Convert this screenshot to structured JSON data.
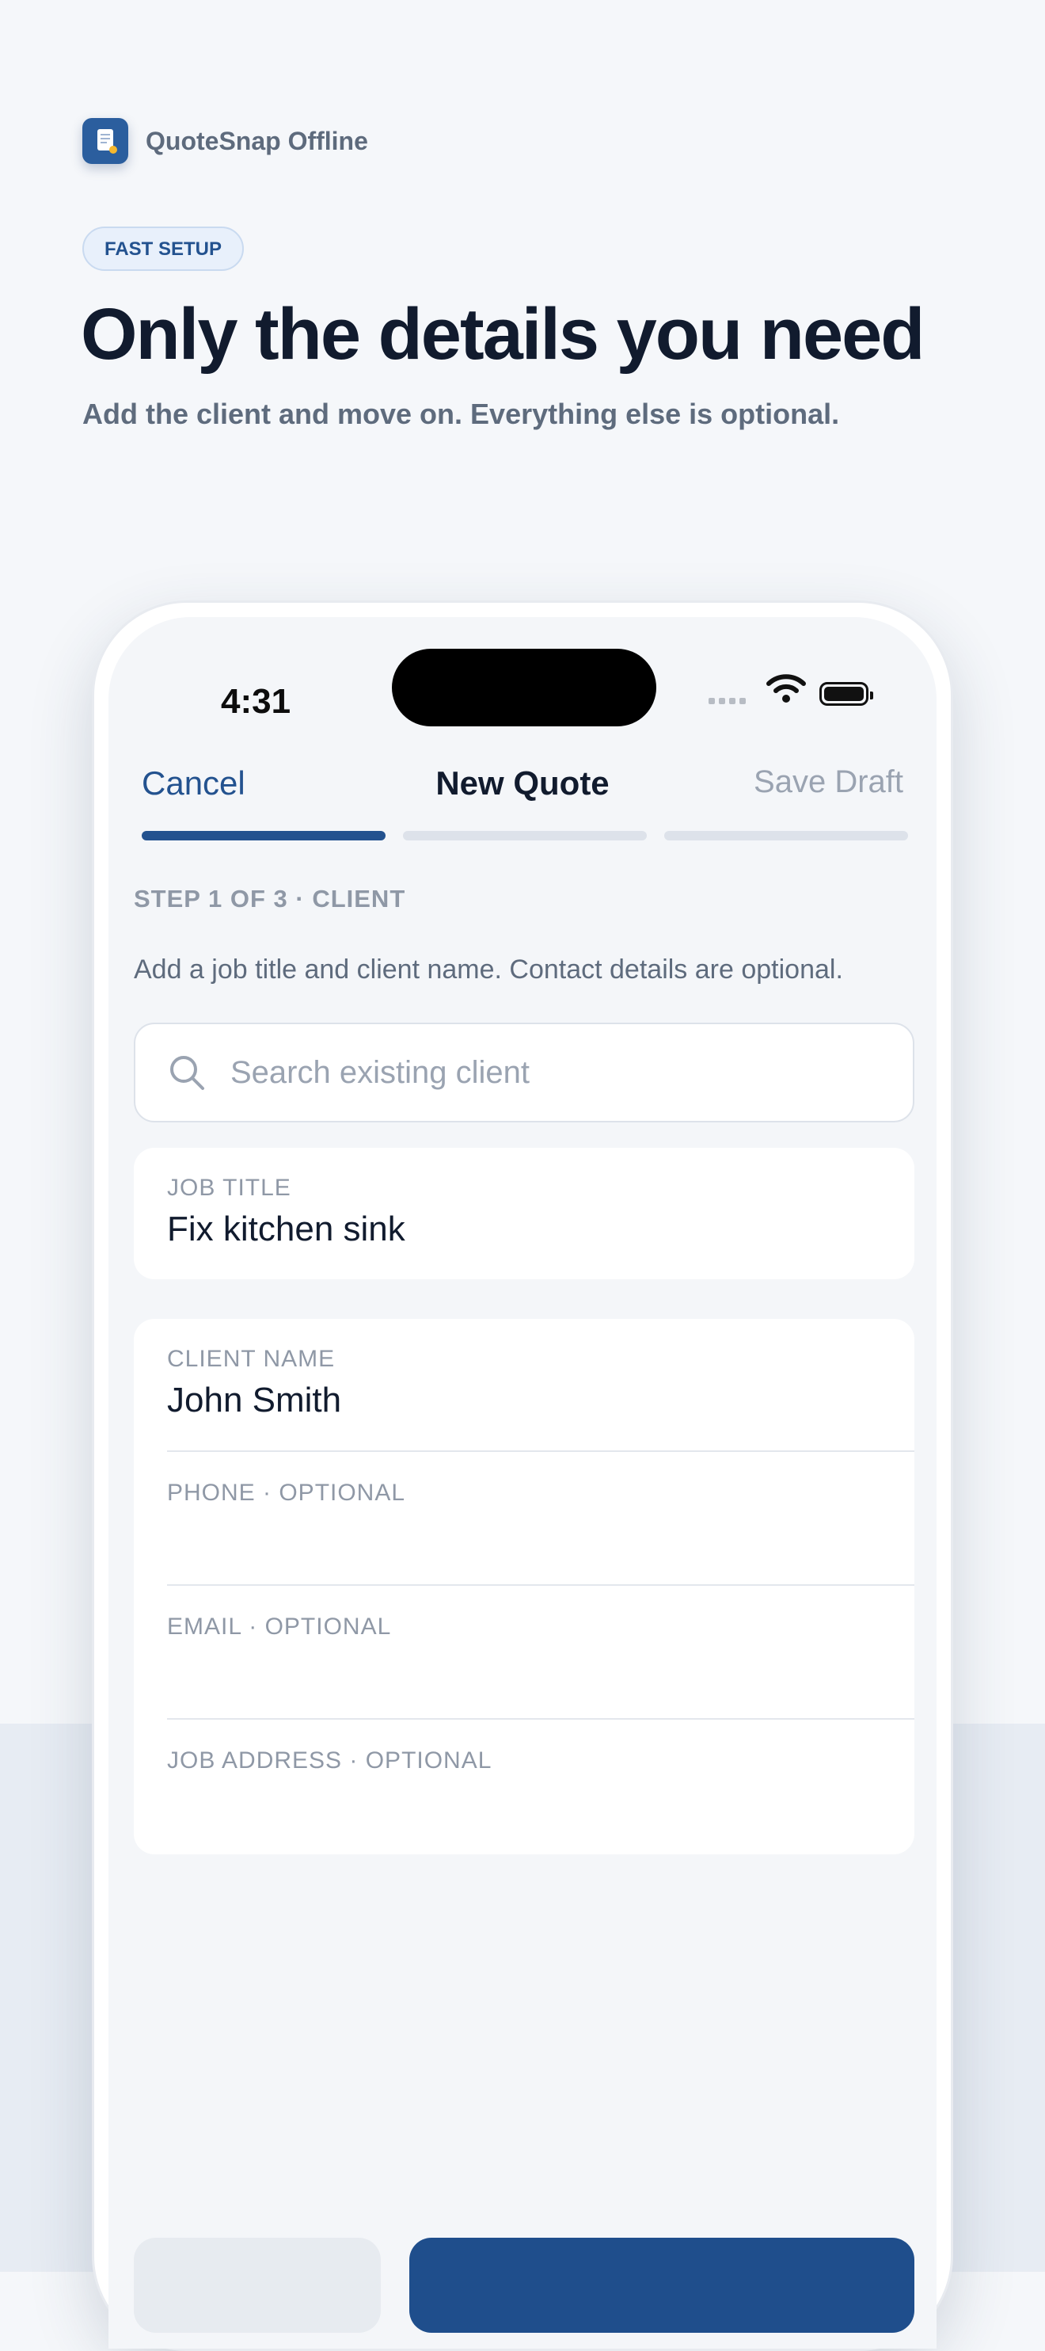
{
  "brand": {
    "name": "QuoteSnap Offline",
    "icon": "document-icon"
  },
  "badge": "FAST SETUP",
  "headline": "Only the details you need",
  "subhead": "Add the client and move on. Everything else is optional.",
  "status_bar": {
    "time": "4:31"
  },
  "nav": {
    "cancel": "Cancel",
    "title": "New Quote",
    "save_draft": "Save Draft"
  },
  "progress": {
    "current_step": 1,
    "total_steps": 3
  },
  "step_label": "STEP 1 OF 3 · CLIENT",
  "helper_text": "Add a job title and client name. Contact details are optional.",
  "search": {
    "placeholder": "Search existing client"
  },
  "fields": {
    "job_title": {
      "label": "JOB TITLE",
      "value": "Fix kitchen sink"
    },
    "client_name": {
      "label": "CLIENT NAME",
      "value": "John Smith"
    },
    "phone": {
      "label": "PHONE · OPTIONAL",
      "value": ""
    },
    "email": {
      "label": "EMAIL · OPTIONAL",
      "value": ""
    },
    "job_address": {
      "label": "JOB ADDRESS · OPTIONAL",
      "value": ""
    }
  },
  "colors": {
    "accent": "#23528f",
    "primary_button": "#1f4e8c",
    "text_dark": "#111b2e",
    "muted": "#8f98a6"
  }
}
